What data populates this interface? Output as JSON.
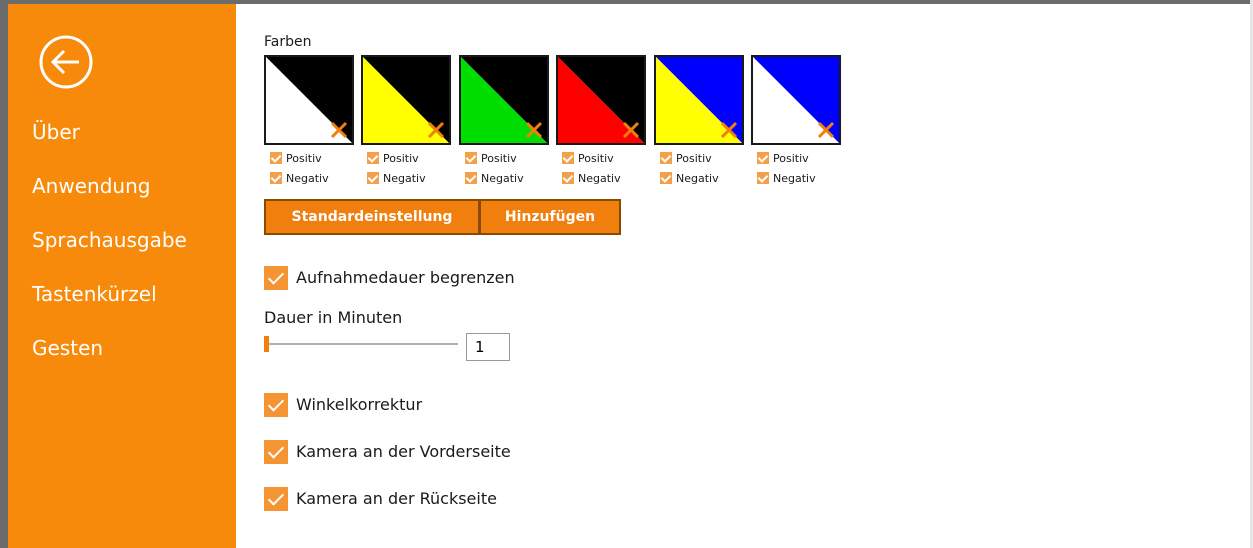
{
  "sidebar": {
    "back_icon": "back-arrow-circle-icon",
    "items": [
      {
        "label": "Über"
      },
      {
        "label": "Anwendung"
      },
      {
        "label": "Sprachausgabe"
      },
      {
        "label": "Tastenkürzel"
      },
      {
        "label": "Gesten"
      }
    ],
    "color": "#f88a0b"
  },
  "colors": {
    "label": "Farben",
    "swatches": [
      {
        "fg": "#ffffff",
        "bg": "#000000",
        "positiv": "Positiv",
        "negativ": "Negativ"
      },
      {
        "fg": "#ffff00",
        "bg": "#000000",
        "positiv": "Positiv",
        "negativ": "Negativ"
      },
      {
        "fg": "#00dd00",
        "bg": "#000000",
        "positiv": "Positiv",
        "negativ": "Negativ"
      },
      {
        "fg": "#ff0000",
        "bg": "#000000",
        "positiv": "Positiv",
        "negativ": "Negativ"
      },
      {
        "fg": "#ffff00",
        "bg": "#0000ff",
        "positiv": "Positiv",
        "negativ": "Negativ"
      },
      {
        "fg": "#ffffff",
        "bg": "#0000ff",
        "positiv": "Positiv",
        "negativ": "Negativ"
      }
    ],
    "delete_icon": "close-x-icon"
  },
  "buttons": {
    "default_label": "Standardeinstellung",
    "add_label": "Hinzufügen"
  },
  "settings": {
    "limit_duration": {
      "label": "Aufnahmedauer begrenzen",
      "checked": true
    },
    "duration_label": "Dauer in Minuten",
    "duration_value": "1",
    "angle_correction": {
      "label": "Winkelkorrektur",
      "checked": true
    },
    "front_camera": {
      "label": "Kamera an der Vorderseite",
      "checked": true
    },
    "rear_camera": {
      "label": "Kamera an der Rückseite",
      "checked": true
    }
  },
  "accent": "#f07f0e"
}
